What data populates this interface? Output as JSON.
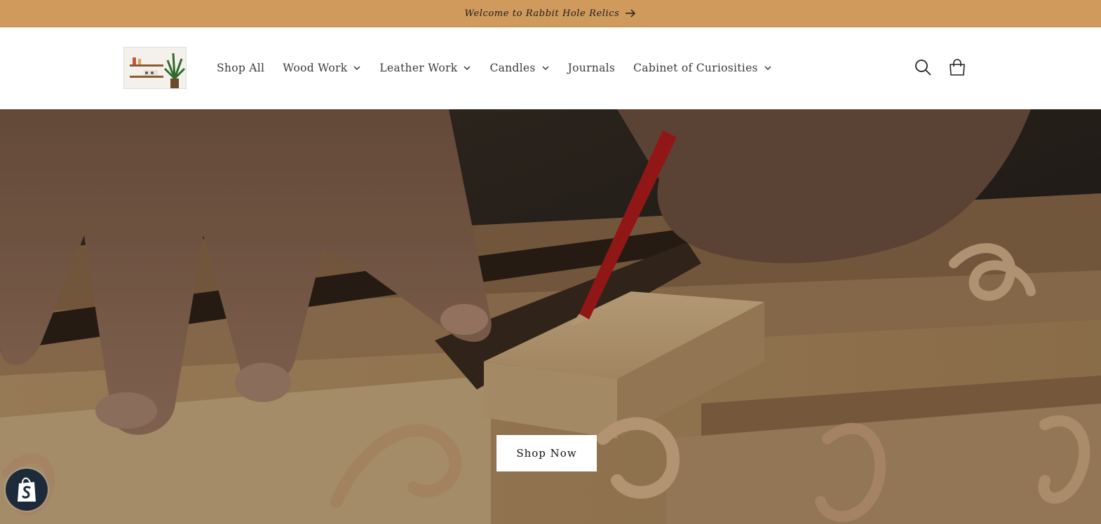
{
  "announcement": {
    "text": "Welcome to Rabbit Hole Relics",
    "arrow_icon": "arrow-right-icon"
  },
  "header": {
    "logo_icon": "shelf-with-plant-logo",
    "nav": [
      {
        "label": "Shop All",
        "dropdown": false
      },
      {
        "label": "Wood Work",
        "dropdown": true
      },
      {
        "label": "Leather Work",
        "dropdown": true
      },
      {
        "label": "Candles",
        "dropdown": true
      },
      {
        "label": "Journals",
        "dropdown": false
      },
      {
        "label": "Cabinet of Curiosities",
        "dropdown": true
      }
    ],
    "search_icon": "search-icon",
    "cart_icon": "cart-icon"
  },
  "hero": {
    "button_label": "Shop Now"
  },
  "colors": {
    "announcement_bg": "#cf9a5c",
    "header_bg": "#ffffff",
    "button_bg": "#ffffff",
    "badge_bg": "#1c2a3a"
  }
}
